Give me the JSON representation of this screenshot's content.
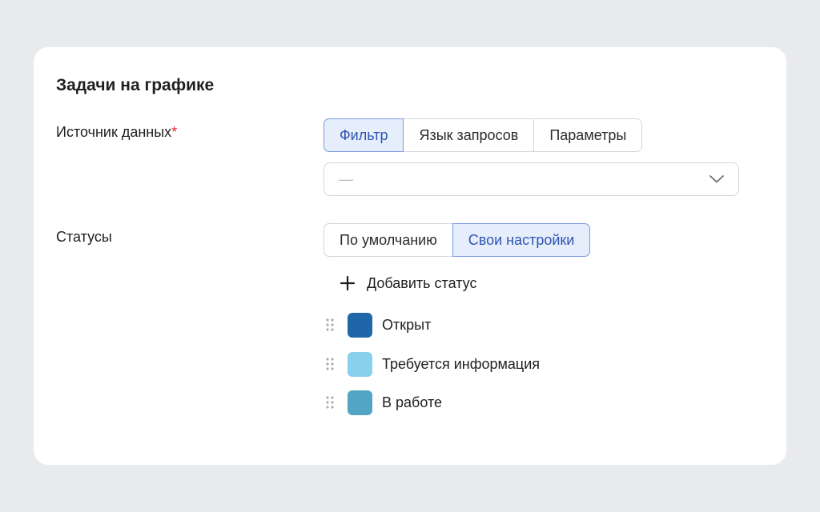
{
  "title": "Задачи на графике",
  "source": {
    "label": "Источник данных",
    "required_mark": "*",
    "tabs": [
      {
        "label": "Фильтр",
        "active": true
      },
      {
        "label": "Язык запросов",
        "active": false
      },
      {
        "label": "Параметры",
        "active": false
      }
    ],
    "select": {
      "value": "—",
      "icon": "chevron-down-icon"
    }
  },
  "statuses": {
    "label": "Статусы",
    "tabs": [
      {
        "label": "По умолчанию",
        "active": false
      },
      {
        "label": "Свои настройки",
        "active": true
      }
    ],
    "add_label": "Добавить статус",
    "items": [
      {
        "name": "Открыт",
        "color": "#1f66a8"
      },
      {
        "name": "Требуется информация",
        "color": "#87d0ee"
      },
      {
        "name": "В работе",
        "color": "#52a5c4"
      }
    ]
  },
  "colors": {
    "accent": "#2f55b3",
    "active_bg": "#e6edfb",
    "active_border": "#7b9be0",
    "required": "#e0262f"
  }
}
